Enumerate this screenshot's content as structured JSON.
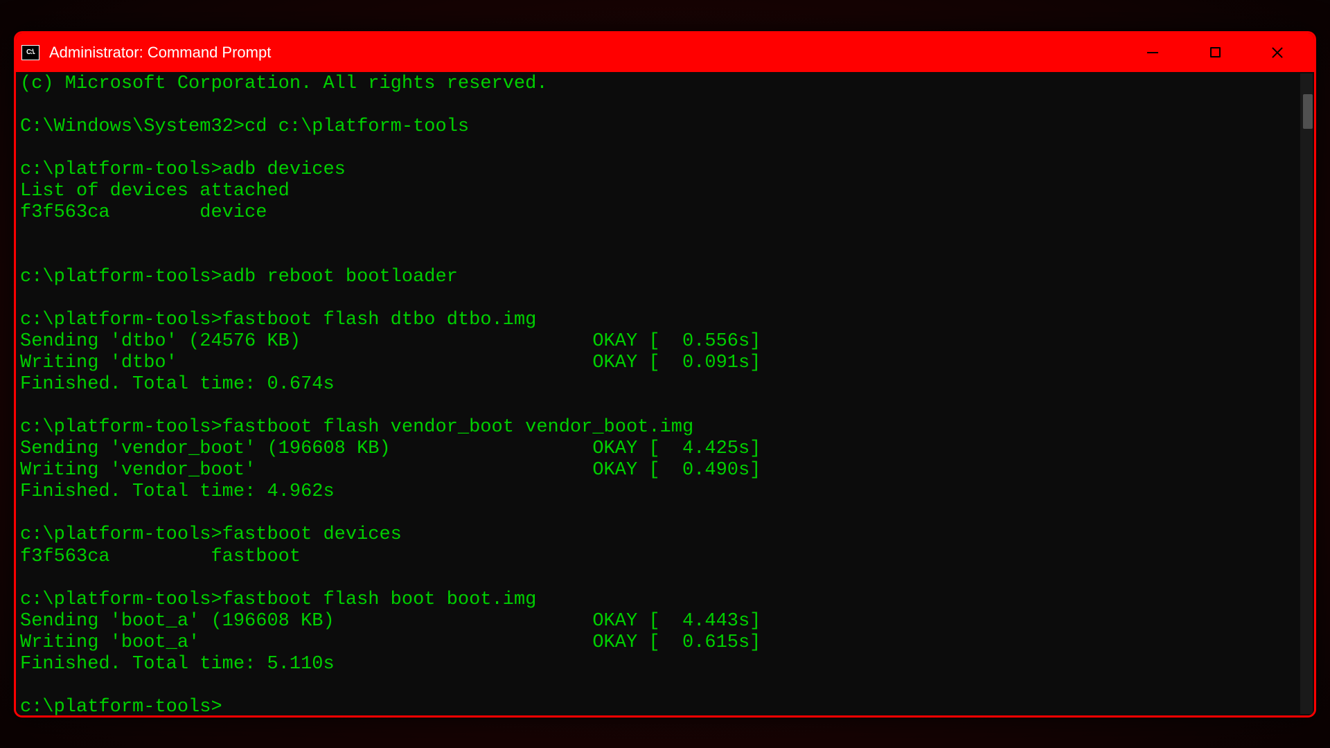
{
  "window": {
    "title": "Administrator: Command Prompt",
    "icon_label": "C:\\."
  },
  "terminal": {
    "lines": [
      "(c) Microsoft Corporation. All rights reserved.",
      "",
      "C:\\Windows\\System32>cd c:\\platform-tools",
      "",
      "c:\\platform-tools>adb devices",
      "List of devices attached",
      "f3f563ca        device",
      "",
      "",
      "c:\\platform-tools>adb reboot bootloader",
      "",
      "c:\\platform-tools>fastboot flash dtbo dtbo.img",
      "Sending 'dtbo' (24576 KB)                          OKAY [  0.556s]",
      "Writing 'dtbo'                                     OKAY [  0.091s]",
      "Finished. Total time: 0.674s",
      "",
      "c:\\platform-tools>fastboot flash vendor_boot vendor_boot.img",
      "Sending 'vendor_boot' (196608 KB)                  OKAY [  4.425s]",
      "Writing 'vendor_boot'                              OKAY [  0.490s]",
      "Finished. Total time: 4.962s",
      "",
      "c:\\platform-tools>fastboot devices",
      "f3f563ca         fastboot",
      "",
      "c:\\platform-tools>fastboot flash boot boot.img",
      "Sending 'boot_a' (196608 KB)                       OKAY [  4.443s]",
      "Writing 'boot_a'                                   OKAY [  0.615s]",
      "Finished. Total time: 5.110s",
      "",
      "c:\\platform-tools>"
    ]
  }
}
